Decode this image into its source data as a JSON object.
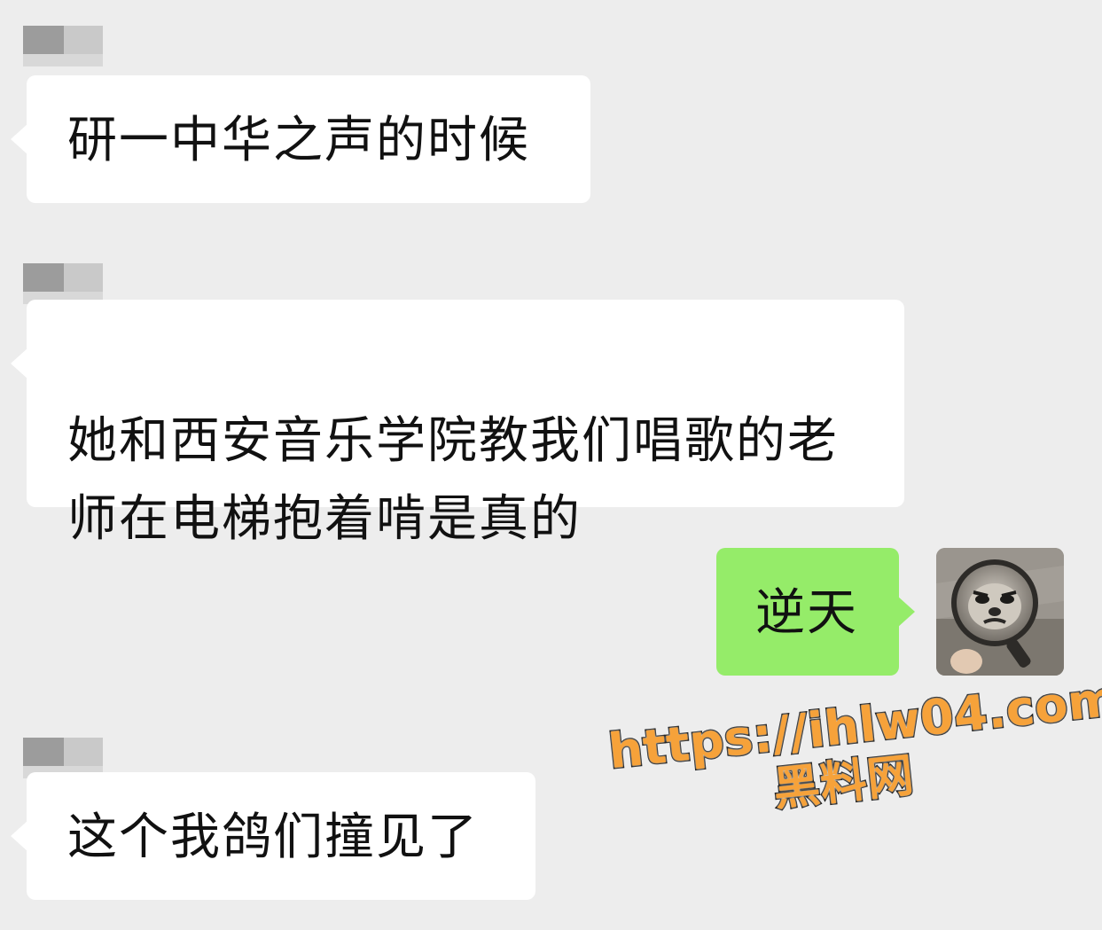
{
  "chat": {
    "messages": [
      {
        "sender": "other",
        "text": "研一中华之声的时候"
      },
      {
        "sender": "other",
        "text": "她和西安音乐学院教我们唱歌的老\n师在电梯抱着啃是真的"
      },
      {
        "sender": "self",
        "text": "逆天"
      },
      {
        "sender": "other",
        "text": "这个我鸽们撞见了"
      }
    ]
  },
  "watermark": {
    "url": "https://ihlw04.com",
    "site_name": "黑料网"
  },
  "colors": {
    "background": "#ededed",
    "incoming_bubble": "#ffffff",
    "outgoing_bubble": "#95ec69",
    "watermark_fill": "#f6a23a"
  }
}
